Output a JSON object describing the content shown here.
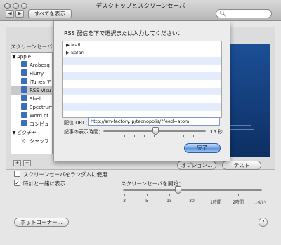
{
  "window": {
    "title": "デスクトップとスクリーンセーバ"
  },
  "toolbar": {
    "back_icon": "◀",
    "forward_icon": "▶",
    "show_all_label": "すべてを表示",
    "search_value": "",
    "search_placeholder": ""
  },
  "main": {
    "list_header": "スクリーンセーバ",
    "list_items": [
      {
        "label": "Apple",
        "kind": "group"
      },
      {
        "label": "Arabesq",
        "kind": "item"
      },
      {
        "label": "Flurry",
        "kind": "item"
      },
      {
        "label": "iTunes ア",
        "kind": "item"
      },
      {
        "label": "RSS Visu",
        "kind": "item",
        "selected": true
      },
      {
        "label": "Shell",
        "kind": "item"
      },
      {
        "label": "Spectrum",
        "kind": "item"
      },
      {
        "label": "Word of",
        "kind": "item"
      },
      {
        "label": "コンピュ",
        "kind": "item"
      },
      {
        "label": "ピクチャ",
        "kind": "group"
      },
      {
        "label": "シャッフ",
        "kind": "item"
      }
    ],
    "add_label": "+",
    "remove_label": "−",
    "options_label": "オプション...",
    "test_label": "テスト",
    "random_label": "スクリーンセーバをランダムに使用",
    "random_checked": false,
    "clock_label": "時計と一緒に表示",
    "clock_checked": true,
    "start_label": "スクリーンセーバを開始：",
    "start_ticks": [
      "3",
      "5",
      "15",
      "30",
      "1時間",
      "2時間",
      "しない"
    ],
    "start_value": "15",
    "hot_corners_label": "ホットコーナー...",
    "help_label": "?"
  },
  "sheet": {
    "title": "RSS 配信を下で選択または入力してください：",
    "feeds": [
      {
        "label": "Mail"
      },
      {
        "label": "Safari"
      }
    ],
    "url_label": "配信 URL：",
    "url_value": "http://am-factory.jp/tecnopolis/?feed=atom",
    "duration_label": "記事の表示時間：",
    "duration_value": "15",
    "duration_unit": "秒",
    "done_label": "完了"
  }
}
